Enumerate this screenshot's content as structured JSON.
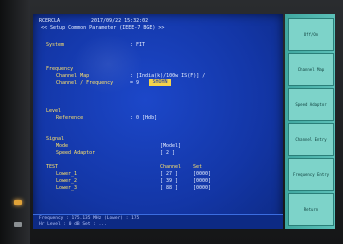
{
  "header": {
    "model": "RCERCLA",
    "datetime": "2017/09/22 15:32:02",
    "title": "<< Setup Common Parameter (IEEE-7 BGE) >>"
  },
  "system": {
    "label": "System",
    "value": ": FIT"
  },
  "frequency": {
    "section": "Frequency",
    "channel_map_label": "Channel Map",
    "channel_map_value": ": [India(k)/100w IS(F)] /",
    "channel_label": "Channel / Frequency",
    "channel_value": "= 9",
    "channel_highlight": "SHOHN"
  },
  "level": {
    "section": "Level",
    "reference_label": "Reference",
    "reference_value": ": 0 [Hdb]"
  },
  "signal": {
    "section": "Signal",
    "mode_label": "Mode",
    "mode_value": "[Model]",
    "speed_label": "Speed Adaptor",
    "speed_value": "[ 2 ]"
  },
  "test": {
    "section": "TEST",
    "col_channel": "Channel",
    "col_rate": "Set",
    "rows": [
      {
        "name": "Lower_1",
        "channel": "[ 27 ]",
        "rate": "[0000]"
      },
      {
        "name": "Lower_2",
        "channel": "[ 39 ]",
        "rate": "[0000]"
      },
      {
        "name": "Lower_3",
        "channel": "[ 88 ]",
        "rate": "[0000]"
      }
    ]
  },
  "footer": {
    "line1": "Frequency : 175.135 MHz  (Lower)  :  175",
    "line2": "Hr   Level : 0  dB    Set  : ..."
  },
  "softkeys": [
    {
      "label": "Off/On"
    },
    {
      "label": "Channel Map"
    },
    {
      "label": "Speed Adaptor"
    },
    {
      "label": "Channel Entry"
    },
    {
      "label": "Frequency Entry"
    },
    {
      "label": "Return"
    }
  ]
}
